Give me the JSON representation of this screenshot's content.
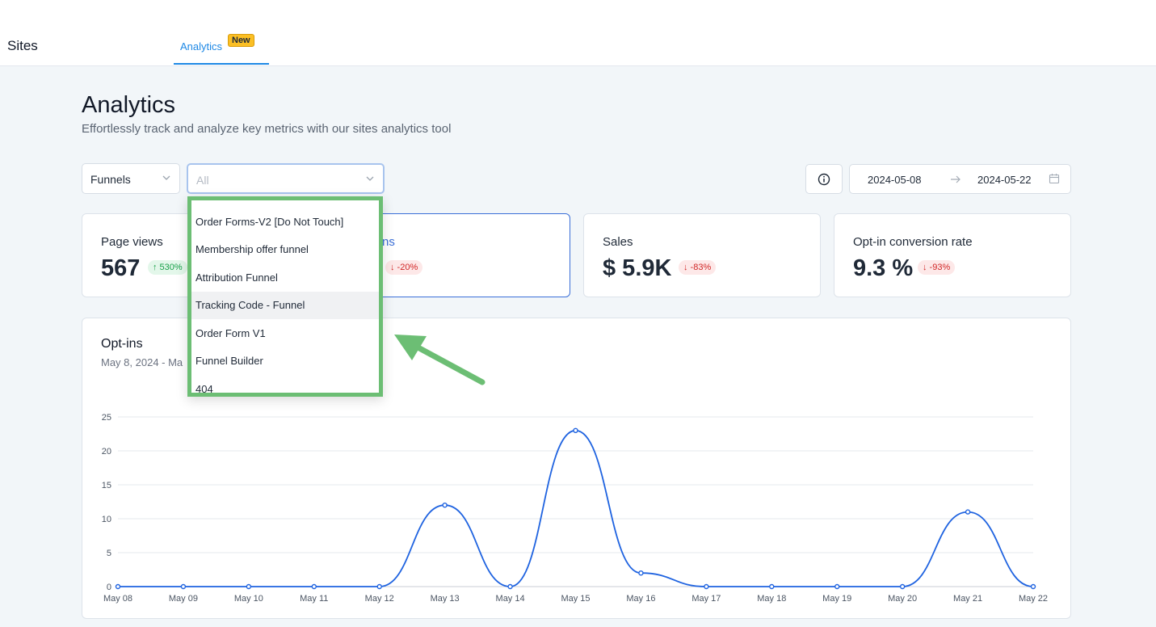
{
  "nav": {
    "brand": "Sites",
    "tab_label": "Analytics",
    "tab_badge": "New"
  },
  "page": {
    "title": "Analytics",
    "subtitle": "Effortlessly track and analyze key metrics with our sites analytics tool"
  },
  "filters": {
    "type_select": "Funnels",
    "item_select_placeholder": "All",
    "date_start": "2024-05-08",
    "date_end": "2024-05-22"
  },
  "dropdown": {
    "items": [
      "Order Forms-V2 [Do Not Touch]",
      "Membership offer funnel",
      "Attribution Funnel",
      "Tracking Code - Funnel",
      "Order Form V1",
      "Funnel Builder",
      "404"
    ],
    "highlighted_index": 3
  },
  "metrics": [
    {
      "label": "Page views",
      "value": "567",
      "change": "↑ 530%",
      "trend": "up"
    },
    {
      "label": "ns",
      "value": "",
      "change": "↓ -20%",
      "trend": "down"
    },
    {
      "label": "Sales",
      "value": "$ 5.9K",
      "change": "↓ -83%",
      "trend": "down"
    },
    {
      "label": "Opt-in conversion rate",
      "value": "9.3 %",
      "change": "↓ -93%",
      "trend": "down"
    }
  ],
  "chart_card": {
    "title": "Opt-ins",
    "subtitle": "May 8, 2024 - Ma"
  },
  "colors": {
    "accent": "#1e88e5",
    "line": "#1f63e0",
    "highlight_frame": "#6cbe74",
    "badge": "#fbbf24"
  },
  "chart_data": {
    "type": "line",
    "title": "Opt-ins",
    "x": [
      "May 08",
      "May 09",
      "May 10",
      "May 11",
      "May 12",
      "May 13",
      "May 14",
      "May 15",
      "May 16",
      "May 17",
      "May 18",
      "May 19",
      "May 20",
      "May 21",
      "May 22"
    ],
    "series": [
      {
        "values": [
          0,
          0,
          0,
          0,
          0,
          12,
          0,
          23,
          2,
          0,
          0,
          0,
          0,
          11,
          0
        ]
      }
    ],
    "ylim": [
      0,
      25
    ],
    "yticks": [
      0,
      5,
      10,
      15,
      20,
      25
    ],
    "grid": true
  }
}
